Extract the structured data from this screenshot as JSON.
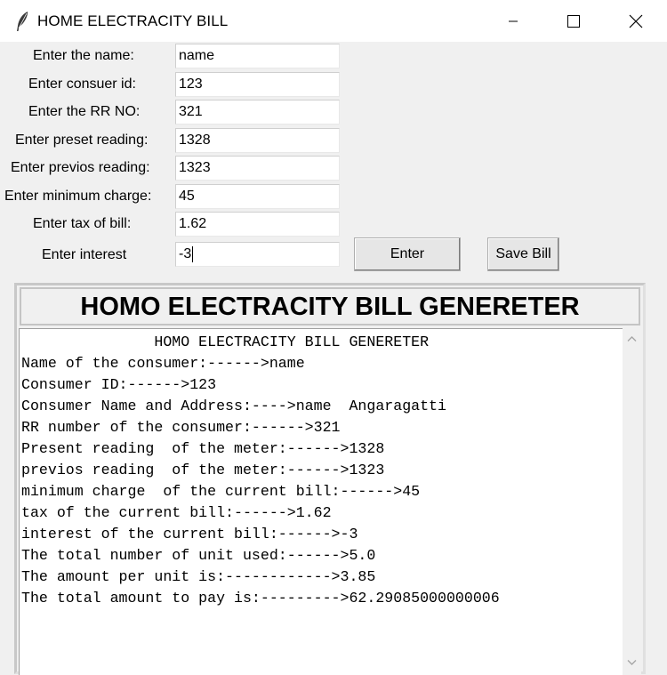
{
  "window": {
    "title": "HOME ELECTRACITY BILL",
    "icons": {
      "app": "feather-icon",
      "minimize": "minimize-icon",
      "maximize": "maximize-icon",
      "close": "close-icon"
    }
  },
  "form": {
    "fields": [
      {
        "label": "Enter the name:",
        "value": "name"
      },
      {
        "label": "Enter consuer id:",
        "value": "123"
      },
      {
        "label": "Enter the RR NO:",
        "value": "321"
      },
      {
        "label": "Enter preset reading:",
        "value": "1328"
      },
      {
        "label": "Enter previos reading:",
        "value": "1323"
      },
      {
        "label": "Enter minimum charge:",
        "value": "45"
      },
      {
        "label": "Enter tax of bill:",
        "value": "1.62"
      },
      {
        "label": "Enter interest",
        "value": "-3"
      }
    ],
    "enter_button": "Enter",
    "save_button": "Save Bill"
  },
  "output": {
    "heading": "HOMO ELECTRACITY BILL GENERETER",
    "lines": [
      "               HOMO ELECTRACITY BILL GENERETER",
      "Name of the consumer:------>name",
      "Consumer ID:------>123",
      "Consumer Name and Address:---->name  Angaragatti",
      "RR number of the consumer:------>321",
      "Present reading  of the meter:------>1328",
      "previos reading  of the meter:------>1323",
      "minimum charge  of the current bill:------>45",
      "tax of the current bill:------>1.62",
      "interest of the current bill:------>-3",
      "The total number of unit used:------>5.0",
      "The amount per unit is:------------>3.85",
      "The total amount to pay is:--------->62.29085000000006"
    ]
  }
}
